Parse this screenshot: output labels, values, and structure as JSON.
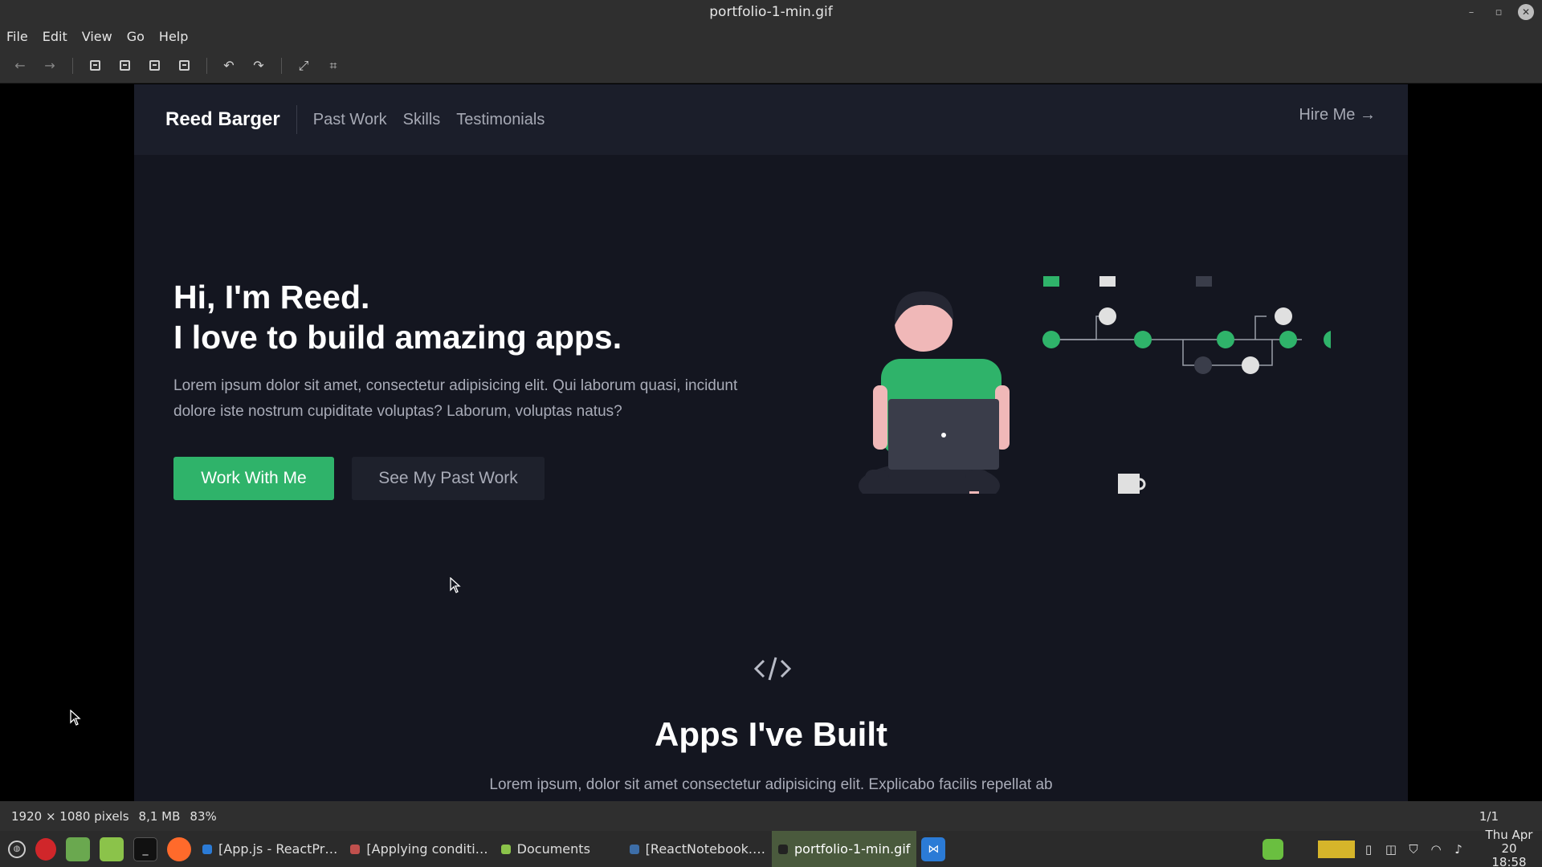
{
  "window": {
    "title": "portfolio-1-min.gif"
  },
  "menu": [
    "File",
    "Edit",
    "View",
    "Go",
    "Help"
  ],
  "toolbar": {
    "icons": [
      "back-arrow-icon",
      "forward-arrow-icon",
      "zoom-out-icon",
      "zoom-in-icon",
      "zoom-fit-icon",
      "zoom-original-icon",
      "rotate-left-icon",
      "rotate-right-icon",
      "fullscreen-icon",
      "slideshow-icon"
    ]
  },
  "site": {
    "brand": "Reed Barger",
    "nav": [
      "Past Work",
      "Skills",
      "Testimonials"
    ],
    "hire": "Hire Me →",
    "hero_line1": "Hi, I'm Reed.",
    "hero_line2": "I love to build amazing apps.",
    "hero_text": "Lorem ipsum dolor sit amet, consectetur adipisicing elit. Qui laborum quasi, incidunt dolore iste nostrum cupiditate voluptas? Laborum, voluptas natus?",
    "btn_primary": "Work With Me",
    "btn_secondary": "See My Past Work",
    "code_glyph": "</>",
    "section_title": "Apps I've Built",
    "section_text": "Lorem ipsum, dolor sit amet consectetur adipisicing elit. Explicabo facilis repellat ab"
  },
  "status": {
    "dimensions": "1920 × 1080 pixels",
    "size": "8,1 MB",
    "zoom": "83%",
    "page": "1/1"
  },
  "taskbar": {
    "windows": [
      "[App.js - ReactPr…",
      "[Applying conditi…",
      "Documents",
      "[ReactNotebook.…",
      "portfolio-1-min.gif"
    ],
    "clock_day": "Thu Apr 20",
    "clock_time": "18:58"
  },
  "colors": {
    "accent_green": "#2fb36a",
    "site_bg": "#141620",
    "nav_bg": "#1b1e2a",
    "chrome": "#2f2f2f"
  }
}
